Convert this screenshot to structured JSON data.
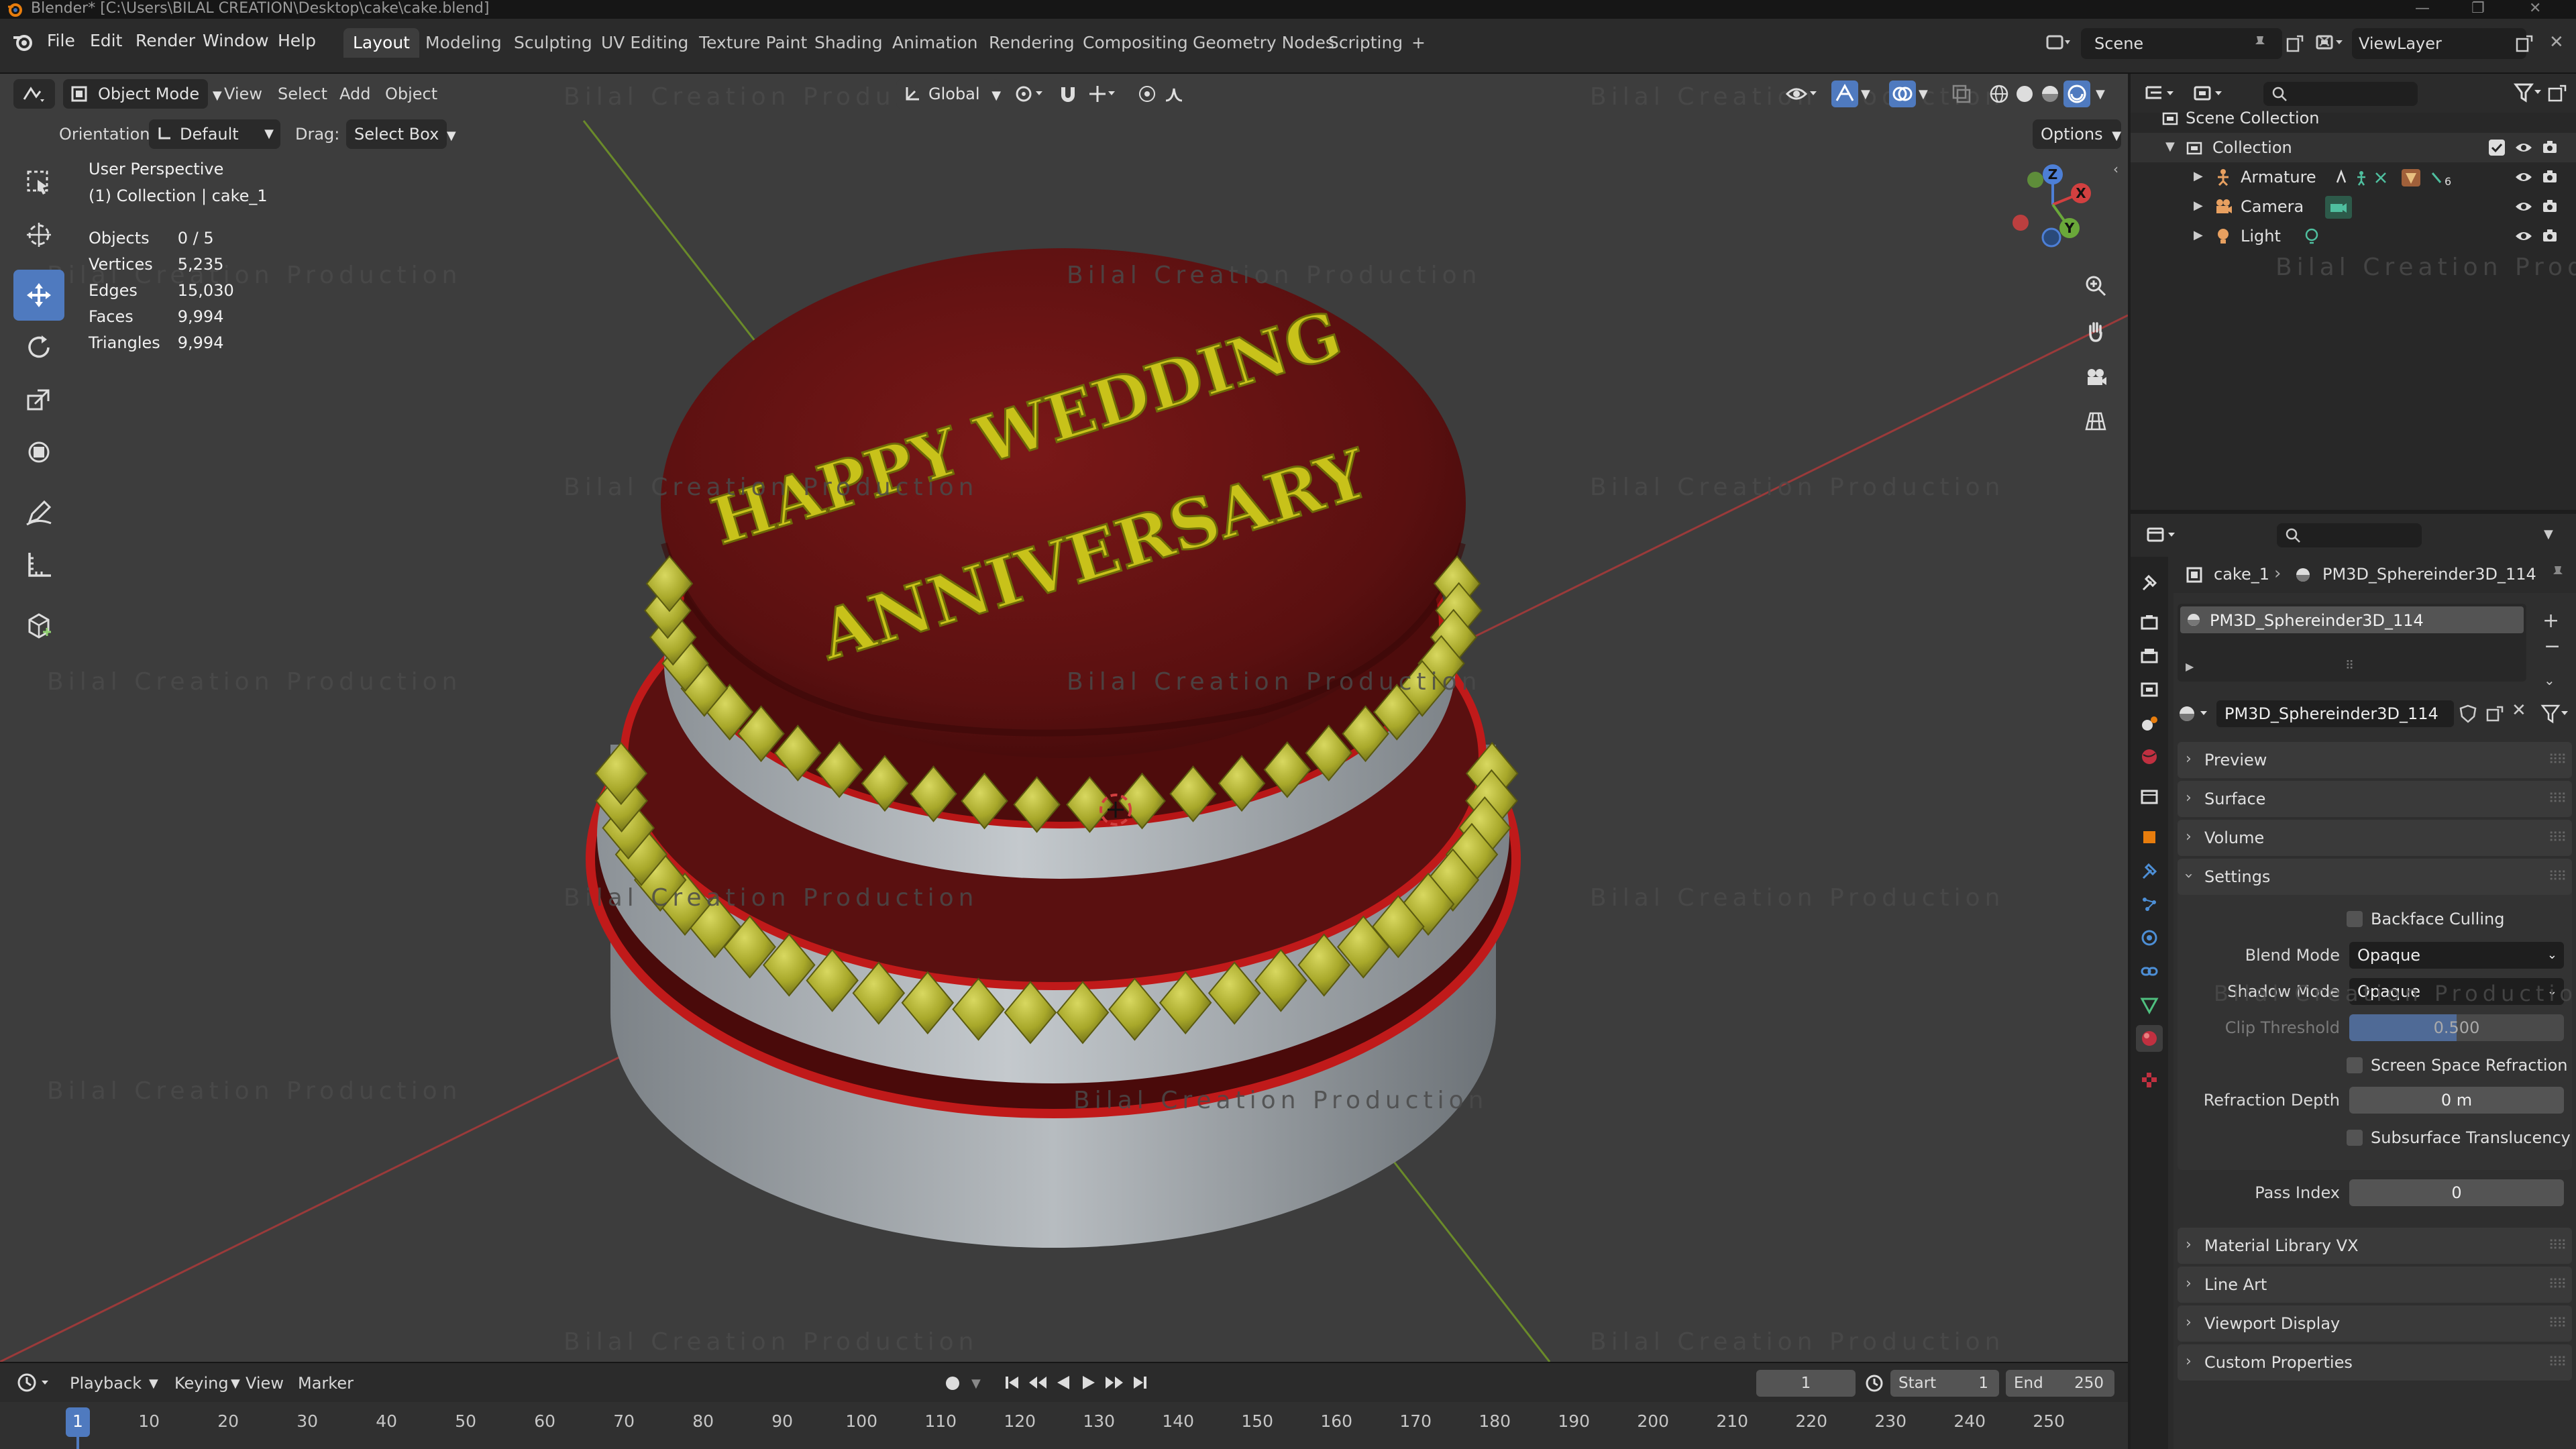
{
  "window": {
    "title": "Blender* [C:\\Users\\BILAL CREATION\\Desktop\\cake\\cake.blend]"
  },
  "menu": [
    "File",
    "Edit",
    "Render",
    "Window",
    "Help"
  ],
  "workspaces": [
    "Layout",
    "Modeling",
    "Sculpting",
    "UV Editing",
    "Texture Paint",
    "Shading",
    "Animation",
    "Rendering",
    "Compositing",
    "Geometry Nodes",
    "Scripting",
    "+"
  ],
  "scene": {
    "name": "Scene",
    "view_layer": "ViewLayer"
  },
  "viewport": {
    "mode": "Object Mode",
    "menus": [
      "View",
      "Select",
      "Add",
      "Object"
    ],
    "transform_orientation": "Global",
    "orientation_label": "Orientation:",
    "orientation_value": "Default",
    "drag_label": "Drag:",
    "drag_value": "Select Box",
    "options": "Options",
    "perspective": "User Perspective",
    "collection_info": "(1) Collection | cake_1",
    "stats": [
      {
        "label": "Objects",
        "value": "0 / 5"
      },
      {
        "label": "Vertices",
        "value": "5,235"
      },
      {
        "label": "Edges",
        "value": "15,030"
      },
      {
        "label": "Faces",
        "value": "9,994"
      },
      {
        "label": "Triangles",
        "value": "9,994"
      }
    ],
    "cake_text_line1": "HAPPY WEDDING",
    "cake_text_line2": "ANNIVERSARY",
    "watermark": "Bilal Creation Production"
  },
  "timeline": {
    "menus": [
      "Playback",
      "Keying",
      "View",
      "Marker"
    ],
    "current_frame": "1",
    "start_label": "Start",
    "start": "1",
    "end_label": "End",
    "end": "250",
    "ticks": [
      "1",
      "10",
      "20",
      "30",
      "40",
      "50",
      "60",
      "70",
      "80",
      "90",
      "100",
      "110",
      "120",
      "130",
      "140",
      "150",
      "160",
      "170",
      "180",
      "190",
      "200",
      "210",
      "220",
      "230",
      "240",
      "250"
    ]
  },
  "outliner": {
    "root": "Scene Collection",
    "collection": "Collection",
    "items": [
      "Armature",
      "Camera",
      "Light"
    ]
  },
  "properties": {
    "breadcrumb_object": "cake_1",
    "breadcrumb_material": "PM3D_Sphereinder3D_114",
    "slot_name": "PM3D_Sphereinder3D_114",
    "material_name": "PM3D_Sphereinder3D_114",
    "sections_top": [
      "Preview",
      "Surface",
      "Volume",
      "Settings"
    ],
    "settings": {
      "backface_culling": "Backface Culling",
      "blend_mode_label": "Blend Mode",
      "blend_mode": "Opaque",
      "shadow_mode_label": "Shadow Mode",
      "shadow_mode": "Opaque",
      "clip_threshold_label": "Clip Threshold",
      "clip_threshold": "0.500",
      "screen_space_refraction": "Screen Space Refraction",
      "refraction_depth_label": "Refraction Depth",
      "refraction_depth": "0 m",
      "subsurface_translucency": "Subsurface Translucency",
      "pass_index_label": "Pass Index",
      "pass_index": "0"
    },
    "sections_bottom": [
      "Material Library VX",
      "Line Art",
      "Viewport Display",
      "Custom Properties"
    ]
  },
  "colors": {
    "accent": "#4f7abf",
    "viewport_bg": "#3d3d3d",
    "cake_red": "#6b1414",
    "icing_white": "#b9bec4",
    "decor_yellow": "#b6b62c"
  }
}
